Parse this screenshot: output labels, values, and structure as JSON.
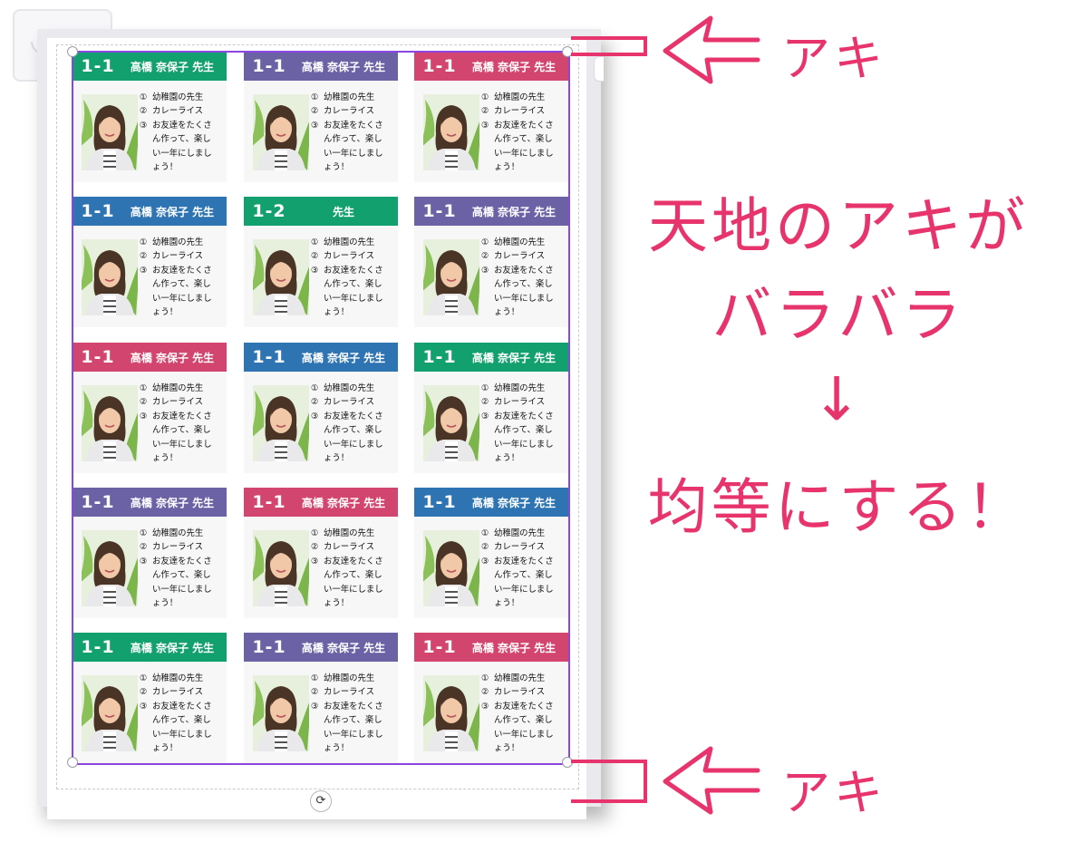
{
  "colors": {
    "green": "#13a06f",
    "purple": "#6b62a6",
    "pink": "#d2456e",
    "blue": "#2e74b2",
    "accent": "#e8346c",
    "selection": "#8b45e0"
  },
  "cards": [
    {
      "class": "1-1",
      "name": "高橋 奈保子 先生",
      "color": "#13a06f"
    },
    {
      "class": "1-1",
      "name": "高橋 奈保子 先生",
      "color": "#6b62a6"
    },
    {
      "class": "1-1",
      "name": "高橋 奈保子 先生",
      "color": "#d2456e"
    },
    {
      "class": "1-1",
      "name": "高橋 奈保子 先生",
      "color": "#2e74b2"
    },
    {
      "class": "1-2",
      "name": "先生",
      "color": "#13a06f"
    },
    {
      "class": "1-1",
      "name": "高橋 奈保子 先生",
      "color": "#6b62a6"
    },
    {
      "class": "1-1",
      "name": "高橋 奈保子 先生",
      "color": "#d2456e"
    },
    {
      "class": "1-1",
      "name": "高橋 奈保子 先生",
      "color": "#2e74b2"
    },
    {
      "class": "1-1",
      "name": "高橋 奈保子 先生",
      "color": "#13a06f"
    },
    {
      "class": "1-1",
      "name": "高橋 奈保子 先生",
      "color": "#6b62a6"
    },
    {
      "class": "1-1",
      "name": "高橋 奈保子 先生",
      "color": "#d2456e"
    },
    {
      "class": "1-1",
      "name": "高橋 奈保子 先生",
      "color": "#2e74b2"
    },
    {
      "class": "1-1",
      "name": "高橋 奈保子 先生",
      "color": "#13a06f"
    },
    {
      "class": "1-1",
      "name": "高橋 奈保子 先生",
      "color": "#6b62a6"
    },
    {
      "class": "1-1",
      "name": "高橋 奈保子 先生",
      "color": "#d2456e"
    }
  ],
  "card_notes": {
    "item1_num": "①",
    "item1": "幼稚園の先生",
    "item2_num": "②",
    "item2": "カレーライス",
    "item3_num": "③",
    "item3": "お友達をたくさ",
    "line4": "ん作って、楽し",
    "line5": "い一年にしまし",
    "line6": "ょう！"
  },
  "annotations": {
    "top_label": "アキ",
    "bottom_label": "アキ",
    "main_line1": "天地のアキが",
    "main_line2": "バラバラ",
    "arrow": "↓",
    "main_line3": "均等にする！"
  },
  "editor": {
    "rotate_icon": "rotate-icon"
  }
}
